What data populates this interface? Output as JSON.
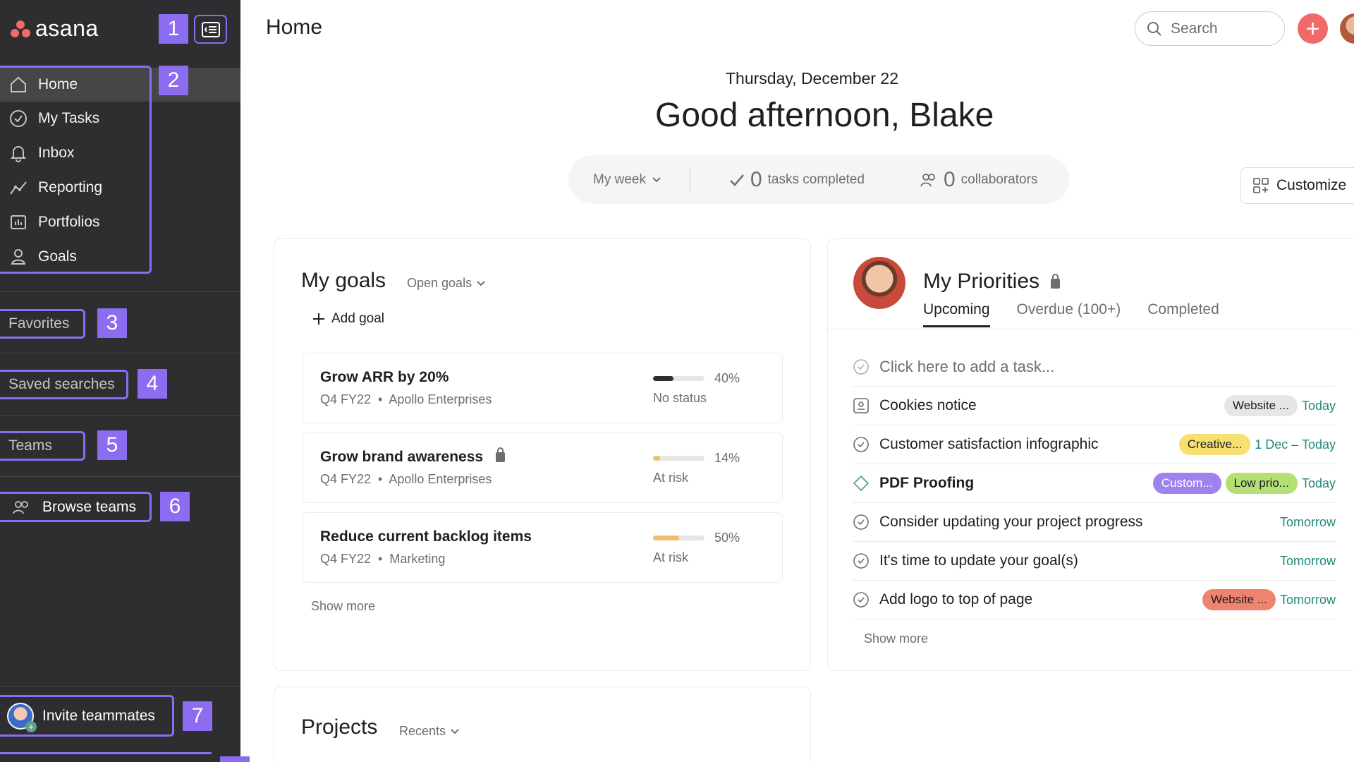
{
  "app": {
    "logo_text": "asana",
    "page_title": "Home"
  },
  "annotations": [
    "1",
    "2",
    "3",
    "4",
    "5",
    "6",
    "7"
  ],
  "sidebar": {
    "nav": [
      {
        "label": "Home",
        "icon": "home-icon"
      },
      {
        "label": "My Tasks",
        "icon": "check-circle-icon"
      },
      {
        "label": "Inbox",
        "icon": "bell-icon"
      },
      {
        "label": "Reporting",
        "icon": "chart-line-icon"
      },
      {
        "label": "Portfolios",
        "icon": "portfolio-icon"
      },
      {
        "label": "Goals",
        "icon": "person-icon"
      }
    ],
    "favorites": "Favorites",
    "saved_searches": "Saved searches",
    "teams": "Teams",
    "browse_teams": "Browse teams",
    "invite": "Invite teammates"
  },
  "topbar": {
    "search_placeholder": "Search",
    "add_label": "+"
  },
  "home": {
    "date": "Thursday, December 22",
    "greeting": "Good afternoon, Blake",
    "stats": {
      "period": "My week",
      "tasks_count": "0",
      "tasks_label": "tasks completed",
      "collab_count": "0",
      "collab_label": "collaborators"
    },
    "customize": "Customize"
  },
  "goals": {
    "title": "My goals",
    "filter": "Open goals",
    "add": "Add goal",
    "items": [
      {
        "name": "Grow ARR by 20%",
        "period": "Q4 FY22",
        "owner": "Apollo Enterprises",
        "pct": "40%",
        "progress": 0.4,
        "status": "No status",
        "color": "#2e2e30",
        "locked": false
      },
      {
        "name": "Grow brand awareness",
        "period": "Q4 FY22",
        "owner": "Apollo Enterprises",
        "pct": "14%",
        "progress": 0.14,
        "status": "At risk",
        "color": "#f1bd6c",
        "locked": true
      },
      {
        "name": "Reduce current backlog items",
        "period": "Q4 FY22",
        "owner": "Marketing",
        "pct": "50%",
        "progress": 0.5,
        "status": "At risk",
        "color": "#f1bd6c",
        "locked": false
      }
    ],
    "show_more": "Show more"
  },
  "priorities": {
    "title": "My Priorities",
    "tabs": [
      "Upcoming",
      "Overdue (100+)",
      "Completed"
    ],
    "add_task": "Click here to add a task...",
    "tasks": [
      {
        "name": "Cookies notice",
        "tags": [
          {
            "label": "Website ...",
            "bg": "#e8e6e4",
            "fg": "#1e1f21"
          }
        ],
        "due": "Today",
        "icon": "approval-icon"
      },
      {
        "name": "Customer satisfaction infographic",
        "tags": [
          {
            "label": "Creative...",
            "bg": "#f8df72",
            "fg": "#1e1f21"
          }
        ],
        "due": "1 Dec – Today",
        "icon": "check-circle-icon"
      },
      {
        "name": "PDF Proofing",
        "tags": [
          {
            "label": "Custom...",
            "bg": "#9e82f0",
            "fg": "#ffffff"
          },
          {
            "label": "Low prio...",
            "bg": "#b3df73",
            "fg": "#1e1f21"
          }
        ],
        "due": "Today",
        "icon": "milestone-icon"
      },
      {
        "name": "Consider updating your project progress",
        "tags": [],
        "due": "Tomorrow",
        "icon": "check-circle-icon"
      },
      {
        "name": "It's time to update your goal(s)",
        "tags": [],
        "due": "Tomorrow",
        "icon": "check-circle-icon"
      },
      {
        "name": "Add logo to top of page",
        "tags": [
          {
            "label": "Website ...",
            "bg": "#f0836f",
            "fg": "#1e1f21"
          }
        ],
        "due": "Tomorrow",
        "icon": "check-circle-icon"
      }
    ],
    "show_more": "Show more"
  },
  "projects": {
    "title": "Projects",
    "filter": "Recents"
  }
}
